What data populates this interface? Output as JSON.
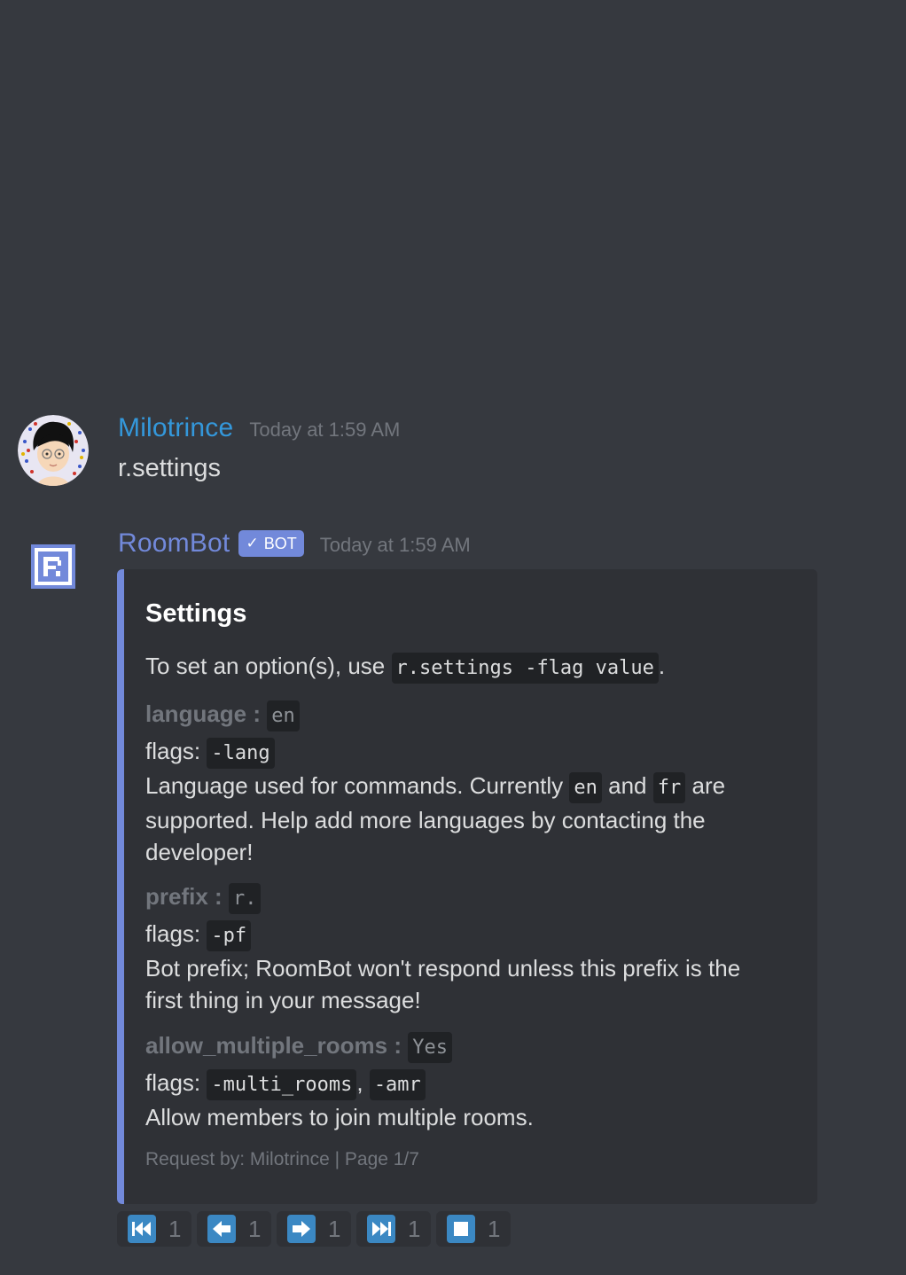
{
  "messages": [
    {
      "username": "Milotrince",
      "username_color": "#3498db",
      "timestamp": "Today at 1:59 AM",
      "content": "r.settings"
    },
    {
      "username": "RoomBot",
      "username_color": "#7289da",
      "bot_tag": "BOT",
      "timestamp": "Today at 1:59 AM",
      "embed": {
        "accent_color": "#7289da",
        "title": "Settings",
        "description_prefix": "To set an option(s), use",
        "description_code": "r.settings -flag value",
        "description_suffix": ".",
        "fields": [
          {
            "name": "language",
            "separator": ":",
            "value": "en",
            "flags_label": "flags:",
            "flags": [
              "-lang"
            ],
            "desc_1": "Language used for commands. Currently",
            "desc_code_1": "en",
            "desc_2": "and",
            "desc_code_2": "fr",
            "desc_3": "are supported. Help add more languages by contacting the developer!"
          },
          {
            "name": "prefix",
            "separator": ":",
            "value": "r.",
            "flags_label": "flags:",
            "flags": [
              "-pf"
            ],
            "desc": "Bot prefix; RoomBot won't respond unless this prefix is the first thing in your message!"
          },
          {
            "name": "allow_multiple_rooms",
            "separator": ":",
            "value": "Yes",
            "flags_label": "flags:",
            "flags": [
              "-multi_rooms",
              "-amr"
            ],
            "flags_sep": ",",
            "desc": "Allow members to join multiple rooms."
          }
        ],
        "footer": "Request by: Milotrince | Page 1/7"
      },
      "reactions": [
        {
          "icon": "track-previous-icon",
          "count": "1"
        },
        {
          "icon": "arrow-left-icon",
          "count": "1"
        },
        {
          "icon": "arrow-right-icon",
          "count": "1"
        },
        {
          "icon": "track-next-icon",
          "count": "1"
        },
        {
          "icon": "stop-icon",
          "count": "1"
        }
      ]
    }
  ]
}
